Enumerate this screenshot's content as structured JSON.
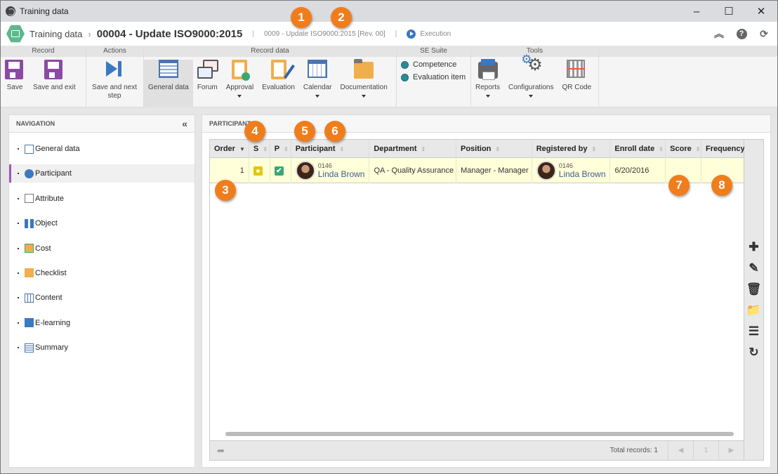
{
  "window": {
    "title": "Training data",
    "controls": {
      "minimize": "–",
      "maximize": "☐",
      "close": "✕"
    }
  },
  "header": {
    "app_name": "Training data",
    "separator": "›",
    "record_title": "00004 - Update ISO9000:2015",
    "divider": "|",
    "subtitle": "0009 - Update ISO9000:2015 [Rev. 00]",
    "status": "Execution",
    "icons": {
      "collapse": "double-chevron-up-icon",
      "help": "?",
      "refresh": "⟳"
    }
  },
  "ribbon": {
    "groups": [
      {
        "title": "Record",
        "buttons": [
          {
            "label": "Save"
          },
          {
            "label": "Save and exit"
          }
        ]
      },
      {
        "title": "Actions",
        "buttons": [
          {
            "label": "Save and next step"
          }
        ]
      },
      {
        "title": "Record data",
        "buttons": [
          {
            "label": "General data",
            "active": true
          },
          {
            "label": "Forum"
          },
          {
            "label": "Approval",
            "dropdown": true
          },
          {
            "label": "Evaluation"
          },
          {
            "label": "Calendar",
            "dropdown": true
          },
          {
            "label": "Documentation",
            "dropdown": true
          }
        ]
      },
      {
        "title": "SE Suite",
        "links": [
          {
            "label": "Competence"
          },
          {
            "label": "Evaluation item"
          }
        ]
      },
      {
        "title": "Tools",
        "buttons": [
          {
            "label": "Reports",
            "dropdown": true
          },
          {
            "label": "Configurations",
            "dropdown": true
          },
          {
            "label": "QR Code"
          }
        ]
      }
    ]
  },
  "navigation": {
    "title": "NAVIGATION",
    "collapse_icon": "«",
    "items": [
      {
        "label": "General data"
      },
      {
        "label": "Participant",
        "selected": true
      },
      {
        "label": "Attribute"
      },
      {
        "label": "Object"
      },
      {
        "label": "Cost"
      },
      {
        "label": "Checklist"
      },
      {
        "label": "Content"
      },
      {
        "label": "E-learning"
      },
      {
        "label": "Summary"
      }
    ]
  },
  "main": {
    "title": "PARTICIPANT",
    "columns": [
      "Order",
      "S",
      "P",
      "Participant",
      "Department",
      "Position",
      "Registered by",
      "Enroll date",
      "Score",
      "Frequency"
    ],
    "rows": [
      {
        "order": "1",
        "s_status": "yellow-dot",
        "p_status": "✔",
        "participant_code": "0146",
        "participant_name": "Linda Brown",
        "department": "QA - Quality Assurance",
        "position": "Manager - Manager",
        "registered_code": "0146",
        "registered_name": "Linda Brown",
        "enroll_date": "6/20/2016",
        "score": "",
        "frequency": ""
      }
    ],
    "footer": {
      "total": "Total records: 1",
      "page": "1",
      "prev": "◀",
      "next": "▶",
      "share_icon": "➦"
    },
    "tools": [
      "✚",
      "✎",
      "🗑",
      "📁",
      "☰",
      "↻"
    ]
  },
  "callouts": [
    "1",
    "2",
    "3",
    "4",
    "5",
    "6",
    "7",
    "8"
  ],
  "colors": {
    "accent_purple": "#9b59b6",
    "callout_orange": "#f07d1c",
    "row_highlight": "#ffffd9",
    "brand_green": "#5cb88e"
  }
}
